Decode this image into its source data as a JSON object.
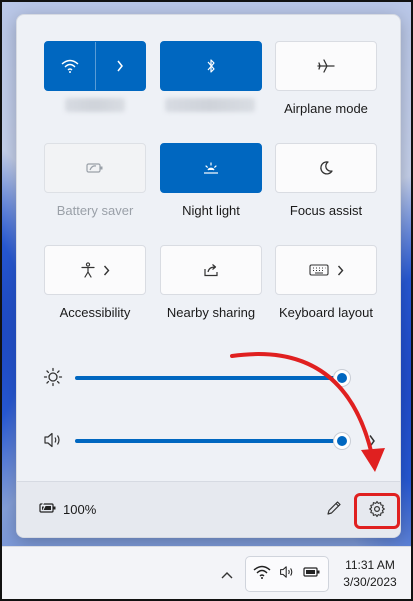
{
  "quick_settings": {
    "tiles": [
      {
        "id": "wifi",
        "label": "",
        "state": "on",
        "icon": "wifi-icon",
        "chevron": true
      },
      {
        "id": "bluetooth",
        "label": "",
        "state": "on",
        "icon": "bluetooth-icon"
      },
      {
        "id": "airplane",
        "label": "Airplane mode",
        "state": "off",
        "icon": "airplane-icon"
      },
      {
        "id": "battery_saver",
        "label": "Battery saver",
        "state": "disabled",
        "icon": "battery-saver-icon"
      },
      {
        "id": "night_light",
        "label": "Night light",
        "state": "on",
        "icon": "night-light-icon"
      },
      {
        "id": "focus_assist",
        "label": "Focus assist",
        "state": "off",
        "icon": "moon-icon"
      },
      {
        "id": "accessibility",
        "label": "Accessibility",
        "state": "off",
        "icon": "accessibility-icon",
        "chevron": true
      },
      {
        "id": "nearby_sharing",
        "label": "Nearby sharing",
        "state": "off",
        "icon": "share-icon"
      },
      {
        "id": "keyboard_layout",
        "label": "Keyboard layout",
        "state": "off",
        "icon": "keyboard-icon",
        "chevron": true
      }
    ],
    "brightness": {
      "icon": "brightness-icon",
      "level": 1.0
    },
    "volume": {
      "icon": "speaker-icon",
      "level": 1.0
    },
    "footer": {
      "battery_percent": "100%",
      "battery_icon": "battery-charging-icon",
      "edit_icon": "pencil-icon",
      "settings_icon": "gear-icon"
    }
  },
  "taskbar": {
    "time": "11:31 AM",
    "date": "3/30/2023",
    "tray_icons": [
      "wifi-icon",
      "speaker-icon",
      "battery-icon"
    ]
  },
  "colors": {
    "accent": "#0067c0",
    "highlight": "#e02020"
  }
}
